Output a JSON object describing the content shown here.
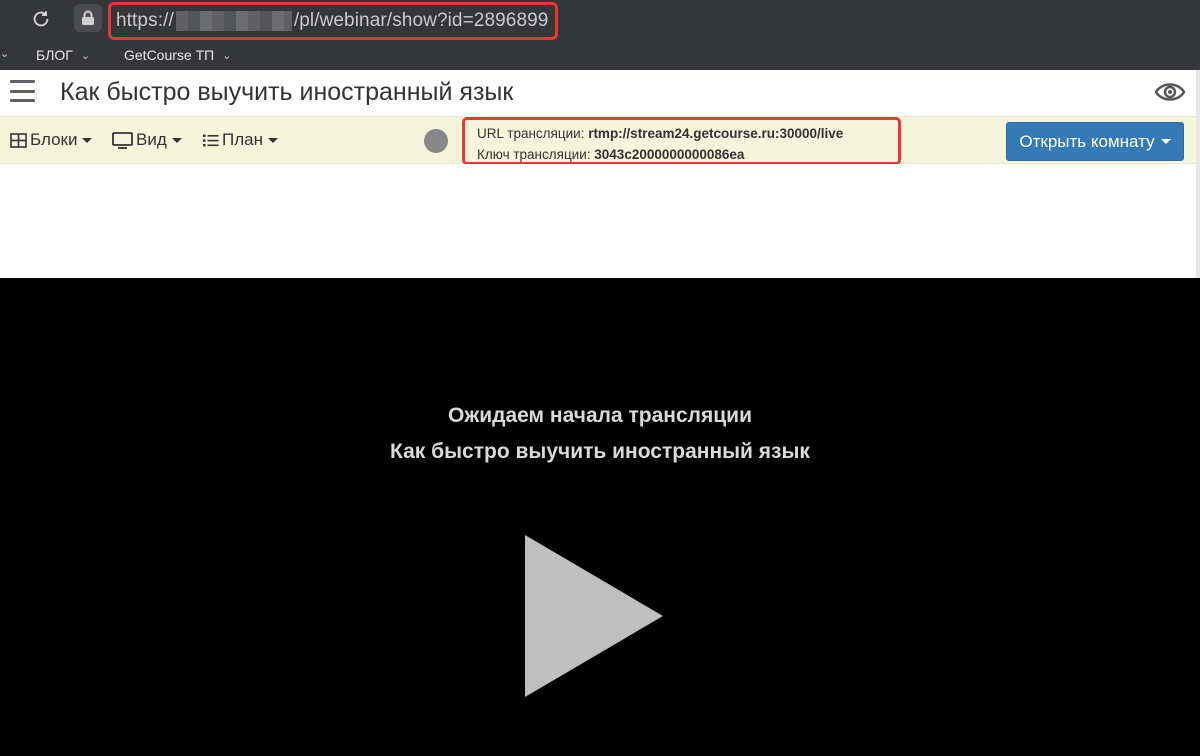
{
  "browser": {
    "url_prefix": "https://",
    "url_suffix": "/pl/webinar/show?id=2896899"
  },
  "bookmarks": [
    {
      "label": "БЛОГ"
    },
    {
      "label": "GetCourse ТП"
    }
  ],
  "header": {
    "title": "Как быстро выучить иностранный язык"
  },
  "toolbar": {
    "blocks_label": "Блоки",
    "view_label": "Вид",
    "plan_label": "План",
    "stream_url_label": "URL трансляции:",
    "stream_url_value": "rtmp://stream24.getcourse.ru:30000/live",
    "stream_key_label": "Ключ трансляции:",
    "stream_key_value": "3043c2000000000086ea",
    "open_room_label": "Открыть комнату"
  },
  "player": {
    "waiting_text": "Ожидаем начала трансляции",
    "title_text": "Как быстро выучить иностранный язык"
  },
  "colors": {
    "highlight": "#e53935",
    "primary_button": "#337ab7",
    "toolbar_bg": "#f5f5dc"
  }
}
